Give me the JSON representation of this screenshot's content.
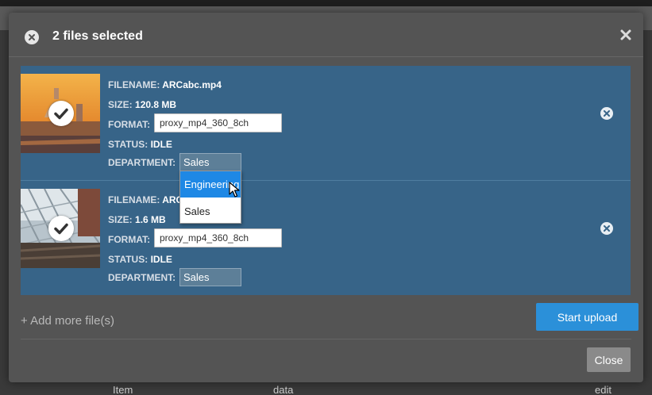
{
  "background": {
    "columns": [
      "Item",
      "data",
      "edit"
    ]
  },
  "modal": {
    "title": "2 files selected",
    "files": [
      {
        "filename_label": "FILENAME:",
        "filename": "ARCabc.mp4",
        "size_label": "SIZE:",
        "size": "120.8 MB",
        "format_label": "FORMAT:",
        "format_value": "proxy_mp4_360_8ch",
        "status_label": "STATUS:",
        "status": "IDLE",
        "department_label": "DEPARTMENT:",
        "department": "Sales"
      },
      {
        "filename_label": "FILENAME:",
        "filename": "ARC",
        "size_label": "SIZE:",
        "size": "1.6 MB",
        "format_label": "FORMAT:",
        "format_value": "proxy_mp4_360_8ch",
        "status_label": "STATUS:",
        "status": "IDLE",
        "department_label": "DEPARTMENT:",
        "department": "Sales"
      }
    ],
    "department_dropdown": {
      "options": [
        "Engineering",
        "Sales"
      ],
      "highlighted": "Engineering"
    },
    "add_more_label": "+ Add more file(s)",
    "start_upload_label": "Start upload",
    "close_label": "Close"
  },
  "colors": {
    "file_list_bg": "#376488",
    "primary_button": "#2b90d9",
    "dropdown_highlight": "#1e88e5"
  },
  "icons": {
    "header": "close-circle-icon",
    "dismiss": "close-x-icon",
    "thumbnail_badge": "checkmark-icon",
    "remove_file": "remove-circle-icon"
  }
}
